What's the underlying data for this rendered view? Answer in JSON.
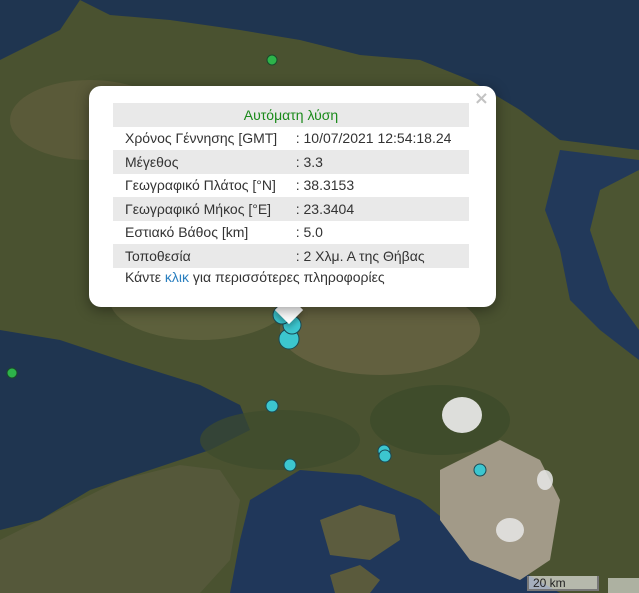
{
  "map": {
    "colors": {
      "sea": "#1f3550",
      "land_dark": "#3b4a2a",
      "land_mid": "#5a5a3a",
      "land_light": "#8a7a5a",
      "city": "#b9b2a6",
      "marker_fill": "#3cc6cf",
      "marker_stroke": "#1a4a55",
      "marker_green": "#2db34a"
    },
    "markers": [
      {
        "name": "epicenter-marker",
        "color": "cyan",
        "size": "large"
      },
      {
        "name": "quake-marker",
        "color": "cyan",
        "size": "small"
      },
      {
        "name": "quake-marker",
        "color": "green",
        "size": "small"
      }
    ]
  },
  "popup": {
    "title": "Αυτόματη λύση",
    "rows": [
      {
        "label": "Χρόνος Γέννησης [GMT]",
        "value": ": 10/07/2021 12:54:18.24"
      },
      {
        "label": "Μέγεθος",
        "value": ": 3.3"
      },
      {
        "label": "Γεωγραφικό Πλάτος [°N]",
        "value": ": 38.3153"
      },
      {
        "label": "Γεωγραφικό Μήκος [°E]",
        "value": ": 23.3404"
      },
      {
        "label": "Εστιακό Βάθος [km]",
        "value": ": 5.0"
      },
      {
        "label": "Τοποθεσία",
        "value": ": 2 Χλμ. Α της Θήβας"
      }
    ],
    "more_prefix": "Κάντε ",
    "more_link": "κλικ",
    "more_suffix": " για περισσότερες πληροφορίες",
    "close_symbol": "×"
  },
  "scale": {
    "label": "20 km"
  }
}
